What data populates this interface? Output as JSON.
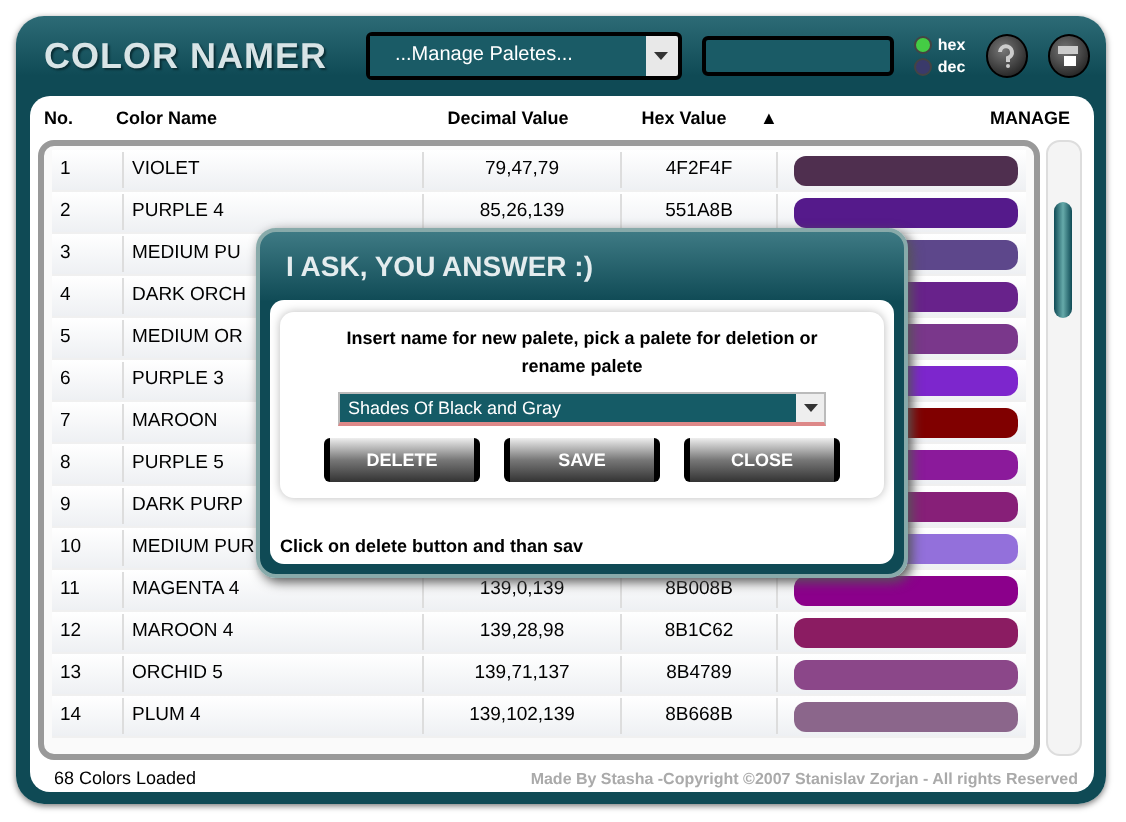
{
  "app": {
    "title": "COLOR NAMER",
    "palette_select": {
      "value": "...Manage Paletes..."
    },
    "mode": [
      {
        "label": "hex",
        "selected": true
      },
      {
        "label": "dec",
        "selected": false
      }
    ]
  },
  "table": {
    "columns": [
      "No.",
      "Color Name",
      "Decimal Value",
      "Hex Value",
      "▲",
      "MANAGE"
    ],
    "rows": [
      {
        "no": "1",
        "name": "VIOLET",
        "decimal": "79,47,79",
        "hex": "4F2F4F",
        "color": "#4f2f4f"
      },
      {
        "no": "2",
        "name": "PURPLE 4",
        "decimal": "85,26,139",
        "hex": "551A8B",
        "color": "#551a8b"
      },
      {
        "no": "3",
        "name": "MEDIUM PU",
        "color": "#5d478b"
      },
      {
        "no": "4",
        "name": "DARK ORCH",
        "color": "#68228b"
      },
      {
        "no": "5",
        "name": "MEDIUM OR",
        "color": "#7a378b"
      },
      {
        "no": "6",
        "name": "PURPLE 3",
        "color": "#7d26cd"
      },
      {
        "no": "7",
        "name": "MAROON",
        "color": "#800000"
      },
      {
        "no": "8",
        "name": "PURPLE 5",
        "color": "#8b1a9b"
      },
      {
        "no": "9",
        "name": "DARK PURP",
        "color": "#871f78"
      },
      {
        "no": "10",
        "name": "MEDIUM PUR",
        "color": "#9370db"
      },
      {
        "no": "11",
        "name": "MAGENTA 4",
        "decimal": "139,0,139",
        "hex": "8B008B",
        "color": "#8b008b"
      },
      {
        "no": "12",
        "name": "MAROON 4",
        "decimal": "139,28,98",
        "hex": "8B1C62",
        "color": "#8b1c62"
      },
      {
        "no": "13",
        "name": "ORCHID 5",
        "decimal": "139,71,137",
        "hex": "8B4789",
        "color": "#8b4789"
      },
      {
        "no": "14",
        "name": "PLUM 4",
        "decimal": "139,102,139",
        "hex": "8B668B",
        "color": "#8b668b"
      }
    ]
  },
  "status": {
    "count": "68 Colors Loaded",
    "credit": "Made By Stasha -Copyright ©2007 Stanislav Zorjan - All rights Reserved"
  },
  "dialog": {
    "title": "I ASK, YOU ANSWER :)",
    "prompt": "Insert name for new palete, pick a palete for deletion or rename palete",
    "palette": "Shades Of Black and Gray",
    "buttons": [
      "DELETE",
      "SAVE",
      "CLOSE"
    ],
    "hint": "Click on delete button and than sav"
  }
}
